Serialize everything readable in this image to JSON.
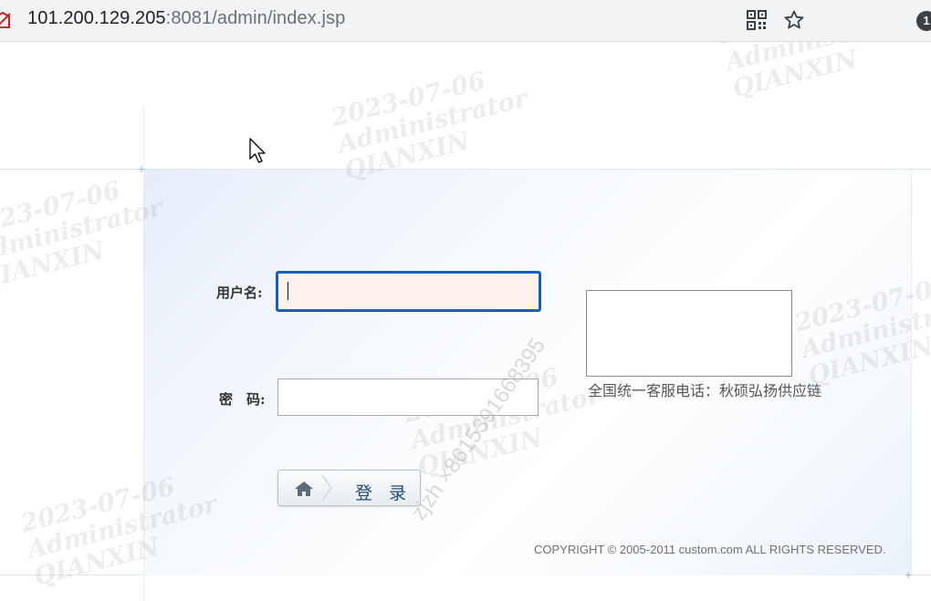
{
  "browser": {
    "url_host": "101.200.129.205",
    "url_rest": ":8081/admin/index.jsp",
    "extension_badge": "1",
    "icons": [
      "site-info-icon",
      "qr-code-icon",
      "star-icon"
    ]
  },
  "login": {
    "username_label": "用户名:",
    "password_label": "密　码:",
    "username_value": "",
    "password_value": "",
    "service_text": "全国统一客服电话：秋硕弘扬供应链",
    "login_button": "登 录"
  },
  "footer": {
    "copyright": "COPYRIGHT © 2005-2011 custom.com ALL RIGHTS RESERVED."
  },
  "watermark": {
    "block": "2023-07-06\nAdministrator\nQIANXIN",
    "diagonal": "zjzh ×8615391668395"
  },
  "colors": {
    "focus_border": "#1a5fb4",
    "input_focus_bg": "#fdf3ec",
    "button_text": "#224a76"
  }
}
